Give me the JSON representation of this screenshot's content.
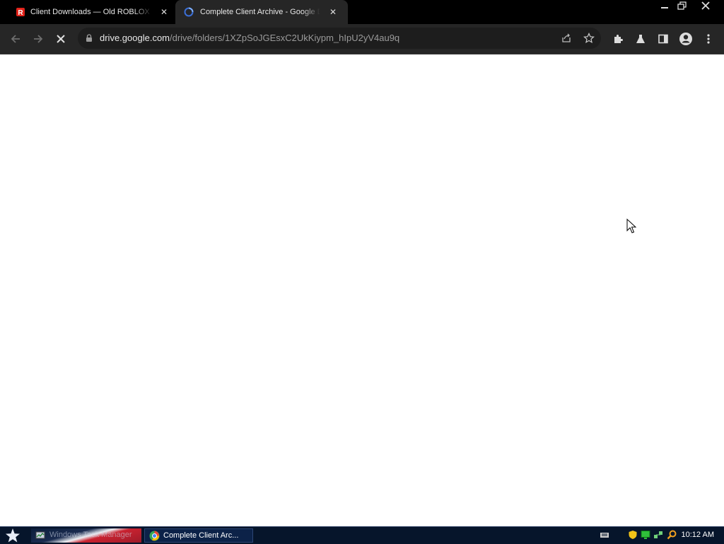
{
  "tabs": [
    {
      "title": "Client Downloads — Old ROBLOX Client",
      "favicon": "roblox-logo-icon",
      "close_label": "✕"
    },
    {
      "title": "Complete Client Archive - Google Drive",
      "favicon": "loading-spinner-icon",
      "close_label": "✕",
      "active": true
    }
  ],
  "window_controls": {
    "minimize": "minimize-icon",
    "restore": "restore-icon",
    "close": "close-icon"
  },
  "toolbar": {
    "url_host": "drive.google.com",
    "url_path": "/drive/folders/1XZpSoJGEsxC2UkKiypm_hIpU2yV4au9q",
    "loading": true
  },
  "taskbar": {
    "items": [
      {
        "label": "Windows Task Manager",
        "icon": "task-manager-icon"
      },
      {
        "label": "Complete Client Arc...",
        "icon": "chrome-icon"
      }
    ],
    "clock": "10:12 AM"
  },
  "colors": {
    "titlebar": "#000000",
    "toolbar": "#262626",
    "page": "#ffffff",
    "taskbar": "#06152b"
  }
}
